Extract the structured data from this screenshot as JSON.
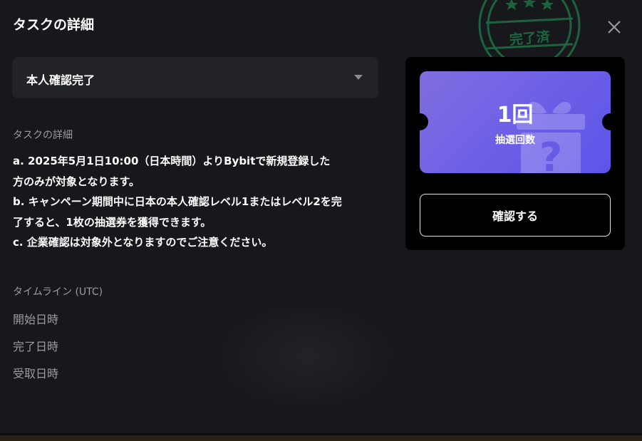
{
  "modal": {
    "title": "タスクの詳細",
    "close_icon": "close-icon"
  },
  "stamp": {
    "text": "完了済",
    "icon": "star-icon"
  },
  "dropdown": {
    "selected": "本人確認完了",
    "icon": "caret-down-icon"
  },
  "details": {
    "heading": "タスクの詳細",
    "lines": [
      "a. 2025年5月1日10:00（日本時間）よりBybitで新規登録した",
      "方のみが対象となります。",
      "b. キャンペーン期間中に日本の本人確認レベル1またはレベル2を完",
      "了すると、1枚の抽選券を獲得できます。",
      "c. 企業確認は対象外となりますのでご注意ください。"
    ]
  },
  "timeline": {
    "heading": "タイムライン (UTC)",
    "start_label": "開始日時",
    "complete_label": "完了日時",
    "receive_label": "受取日時"
  },
  "reward": {
    "count": "1回",
    "count_label": "抽選回数",
    "icon": "gift-question-icon",
    "ticket_colors": [
      "#7f6ee0",
      "#5d54ea"
    ],
    "confirm_button": "確認する"
  }
}
